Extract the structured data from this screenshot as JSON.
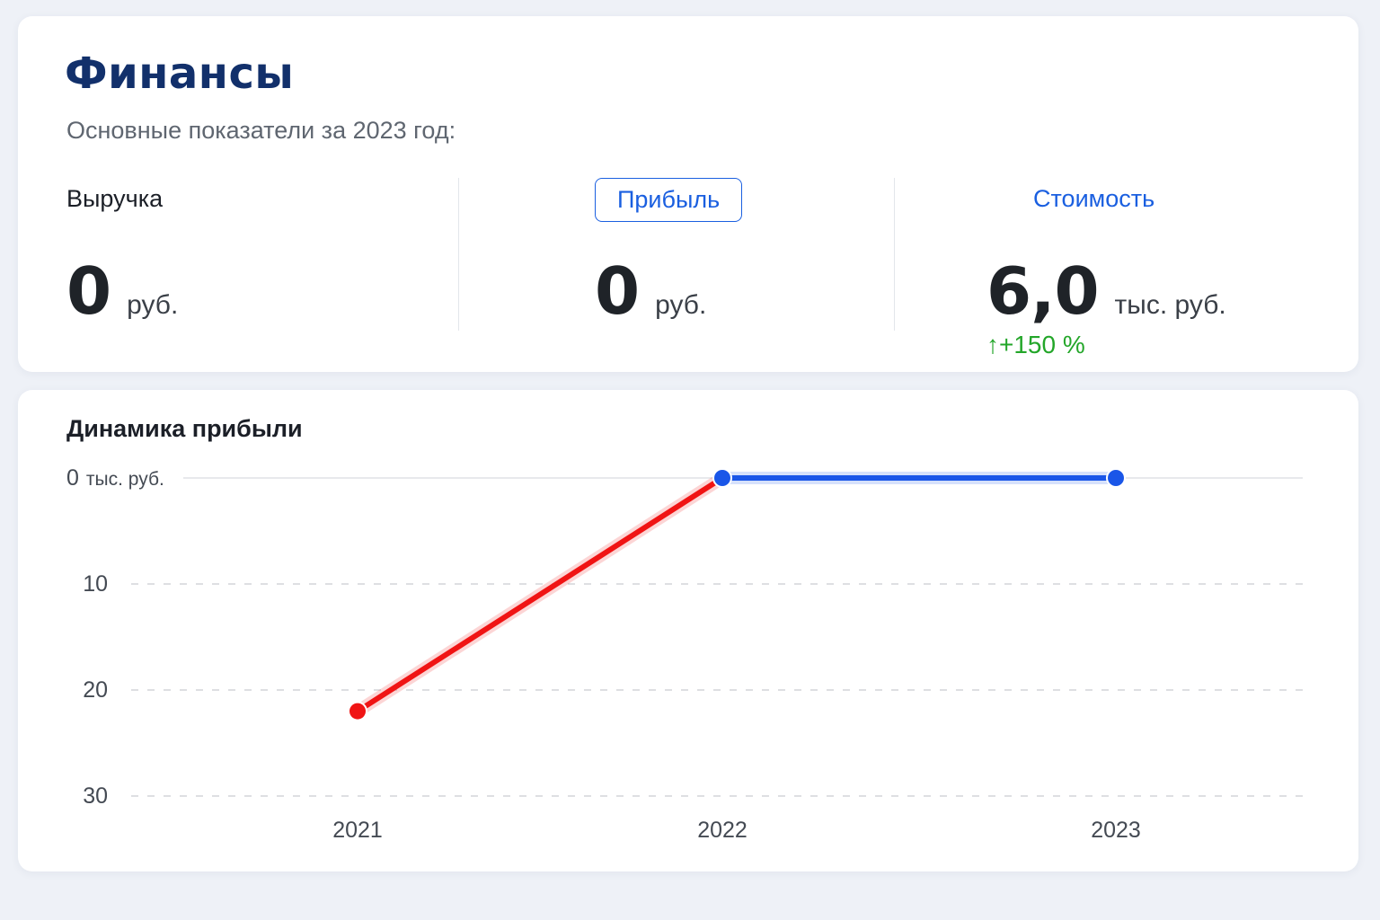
{
  "header": {
    "title": "Финансы",
    "subtitle": "Основные показатели за 2023 год:"
  },
  "metrics": [
    {
      "label": "Выручка",
      "value": "0",
      "unit": "руб.",
      "change": ""
    },
    {
      "label": "Прибыль",
      "value": "0",
      "unit": "руб.",
      "change": ""
    },
    {
      "label": "Стоимость",
      "value": "6,0",
      "unit": "тыс. руб.",
      "change": "↑+150 %"
    }
  ],
  "chart": {
    "title": "Динамика прибыли"
  },
  "colors": {
    "accent": "#1a5fe0",
    "title": "#12306b",
    "positive": "#23a629",
    "negative_series": "#f01414",
    "positive_series": "#1a56e8"
  },
  "chart_data": {
    "type": "line",
    "x": [
      "2021",
      "2022",
      "2023"
    ],
    "values": [
      -22,
      0,
      0
    ],
    "segment_colors": [
      "#f01414",
      "#1a56e8"
    ],
    "y_ticks": [
      0,
      -10,
      -20,
      -30
    ],
    "y_tick_labels": [
      "0",
      "10",
      "20",
      "30"
    ],
    "y_top_unit": "тыс. руб.",
    "ylim": [
      -30,
      0
    ],
    "grid": true,
    "title": "Динамика прибыли"
  }
}
